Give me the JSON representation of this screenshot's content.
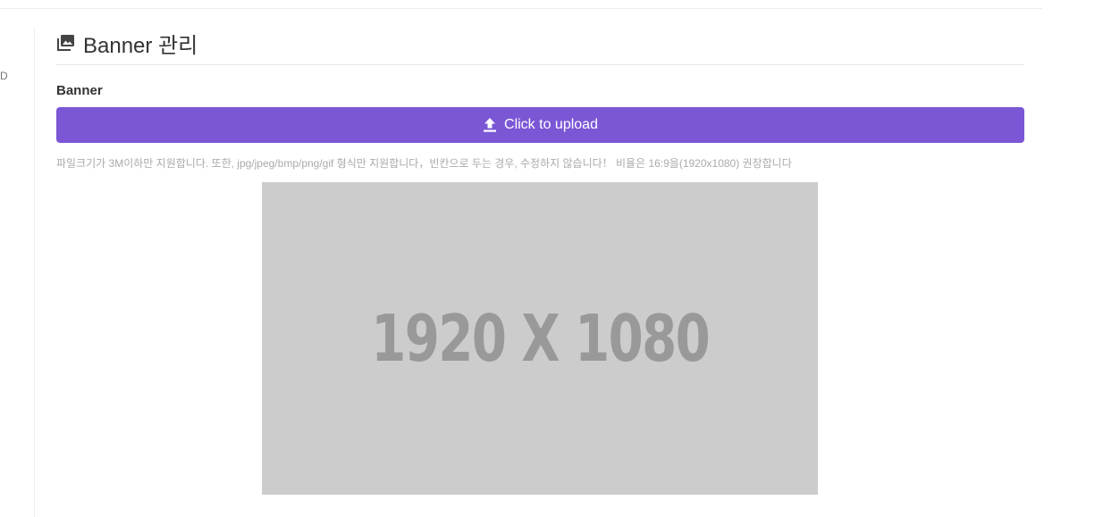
{
  "sidebar": {
    "partial_label": "D"
  },
  "header": {
    "title": "Banner 관리",
    "icon": "images-icon"
  },
  "form": {
    "field_label": "Banner",
    "upload_button_label": "Click to upload",
    "upload_icon": "upload-icon",
    "help_text": "파일크기가 3M이하만 지원합니다. 또한, jpg/jpeg/bmp/png/gif 형식만 지원합니다，빈칸으로 두는 경우, 수정하지 않습니다！ 비율은 16:9을(1920x1080) 권장합니다"
  },
  "preview": {
    "placeholder_text": "1920 X 1080"
  },
  "colors": {
    "accent": "#7b57d6",
    "placeholder_bg": "#cccccc",
    "placeholder_text": "#999999"
  }
}
